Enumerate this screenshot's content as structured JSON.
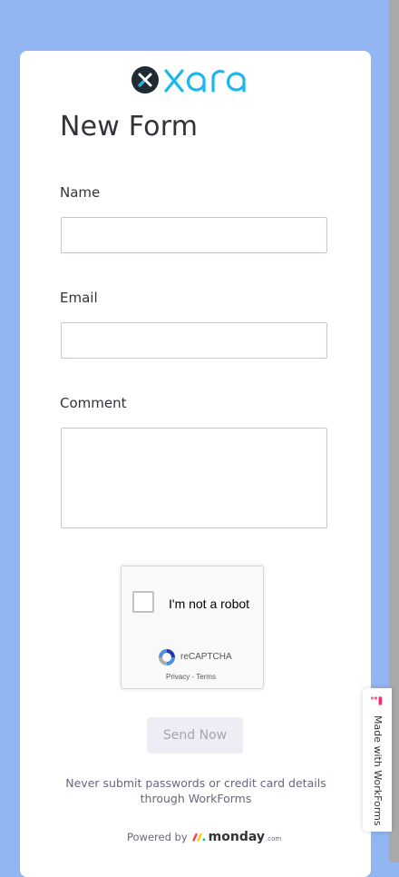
{
  "logo": {
    "brand": "xara",
    "mark_icon": "xara-x-icon",
    "color": "#1ab8ec"
  },
  "form": {
    "title": "New Form",
    "fields": [
      {
        "label": "Name",
        "value": ""
      },
      {
        "label": "Email",
        "value": ""
      },
      {
        "label": "Comment",
        "value": ""
      }
    ]
  },
  "recaptcha": {
    "checkbox_label": "I'm not a robot",
    "brand": "reCAPTCHA",
    "links": "Privacy - Terms",
    "icon": "recaptcha-icon"
  },
  "submit": {
    "label": "Send Now"
  },
  "disclaimer": "Never submit passwords or credit card details through WorkForms",
  "powered_by": {
    "prefix": "Powered by",
    "brand": "monday",
    "suffix": ".com",
    "icon": "monday-logo-icon"
  },
  "badge": {
    "text": "Made with WorkForms",
    "icon": "workforms-logo-icon"
  },
  "colors": {
    "background": "#92b6f1",
    "card": "#ffffff",
    "text": "#323338",
    "button_bg": "#ecedf5"
  }
}
